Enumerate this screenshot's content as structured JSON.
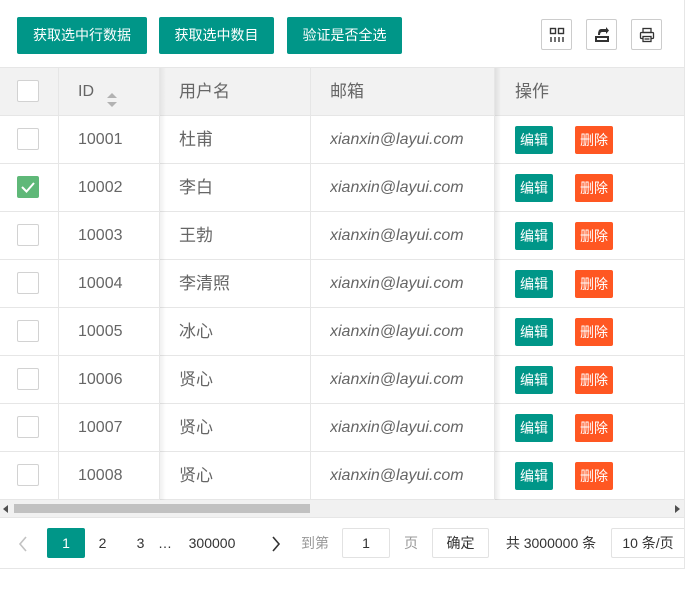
{
  "toolbar": {
    "btn_get_rows": "获取选中行数据",
    "btn_get_count": "获取选中数目",
    "btn_check_all": "验证是否全选",
    "icons": [
      "cols-icon",
      "export-icon",
      "print-icon"
    ]
  },
  "table": {
    "headers": {
      "id": "ID",
      "username": "用户名",
      "email": "邮箱",
      "actions": "操作"
    },
    "rows": [
      {
        "id": "10001",
        "username": "杜甫",
        "email": "xianxin@layui.com",
        "checked": false
      },
      {
        "id": "10002",
        "username": "李白",
        "email": "xianxin@layui.com",
        "checked": true
      },
      {
        "id": "10003",
        "username": "王勃",
        "email": "xianxin@layui.com",
        "checked": false
      },
      {
        "id": "10004",
        "username": "李清照",
        "email": "xianxin@layui.com",
        "checked": false
      },
      {
        "id": "10005",
        "username": "冰心",
        "email": "xianxin@layui.com",
        "checked": false
      },
      {
        "id": "10006",
        "username": "贤心",
        "email": "xianxin@layui.com",
        "checked": false
      },
      {
        "id": "10007",
        "username": "贤心",
        "email": "xianxin@layui.com",
        "checked": false
      },
      {
        "id": "10008",
        "username": "贤心",
        "email": "xianxin@layui.com",
        "checked": false
      }
    ],
    "edit_label": "编辑",
    "delete_label": "删除"
  },
  "pager": {
    "current": "1",
    "pages": [
      "2",
      "3"
    ],
    "ellipsis": "…",
    "last": "300000",
    "goto_label": "到第",
    "goto_value": "1",
    "page_label": "页",
    "confirm": "确定",
    "total": "共 3000000 条",
    "page_size": "10 条/页"
  },
  "colors": {
    "primary": "#009688",
    "danger": "#ff5722",
    "checked": "#5fb878"
  }
}
